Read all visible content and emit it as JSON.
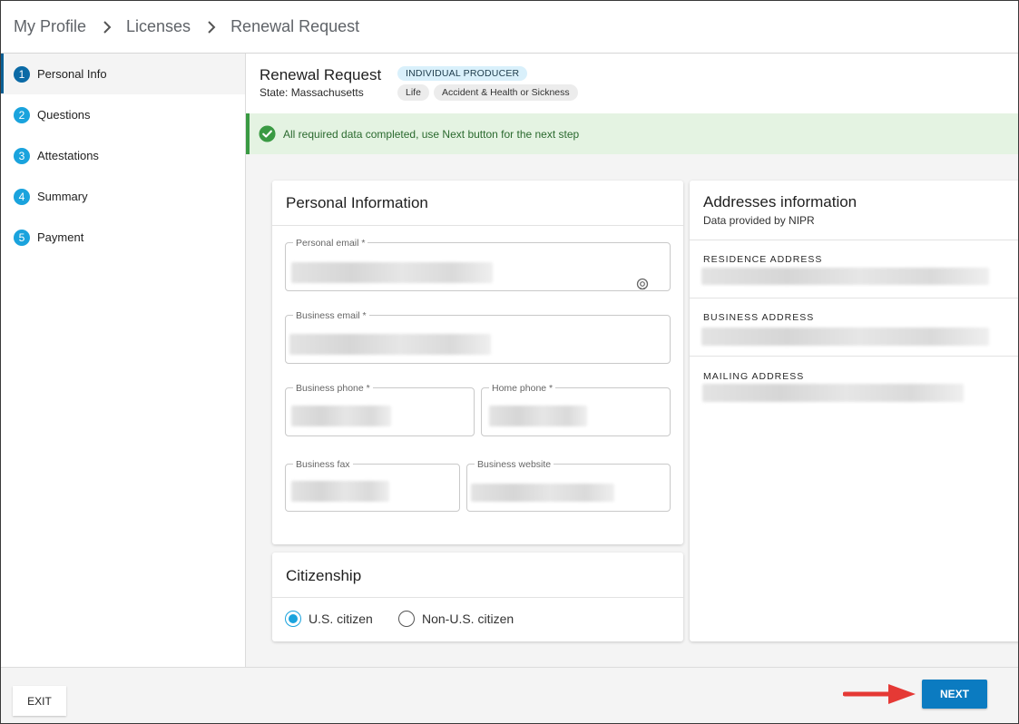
{
  "breadcrumb": {
    "items": [
      "My Profile",
      "Licenses",
      "Renewal Request"
    ]
  },
  "sidebar": {
    "steps": [
      {
        "num": "1",
        "label": "Personal Info"
      },
      {
        "num": "2",
        "label": "Questions"
      },
      {
        "num": "3",
        "label": "Attestations"
      },
      {
        "num": "4",
        "label": "Summary"
      },
      {
        "num": "5",
        "label": "Payment"
      }
    ]
  },
  "request": {
    "title": "Renewal Request",
    "state": "State: Massachusetts",
    "type_badge": "INDIVIDUAL PRODUCER",
    "lines": [
      "Life",
      "Accident & Health or Sickness"
    ]
  },
  "banner": {
    "message": "All required data completed, use Next button for the next step"
  },
  "personal": {
    "title": "Personal Information",
    "fields": {
      "personal_email": "Personal email *",
      "business_email": "Business email *",
      "business_phone": "Business phone *",
      "home_phone": "Home phone *",
      "business_fax": "Business fax",
      "business_website": "Business website"
    }
  },
  "citizenship": {
    "title": "Citizenship",
    "options": [
      "U.S. citizen",
      "Non-U.S. citizen"
    ],
    "selected": "U.S. citizen"
  },
  "addresses": {
    "title": "Addresses information",
    "subtitle": "Data provided by NIPR",
    "residence": "RESIDENCE ADDRESS",
    "business": "BUSINESS ADDRESS",
    "mailing": "MAILING ADDRESS"
  },
  "footer": {
    "exit_label": "EXIT",
    "next_label": "NEXT"
  },
  "colors": {
    "accent": "#0b7bc1",
    "step_active": "#0b6aa6",
    "step": "#1aa3dd",
    "success": "#3a9a43",
    "arrow": "#e53935"
  }
}
